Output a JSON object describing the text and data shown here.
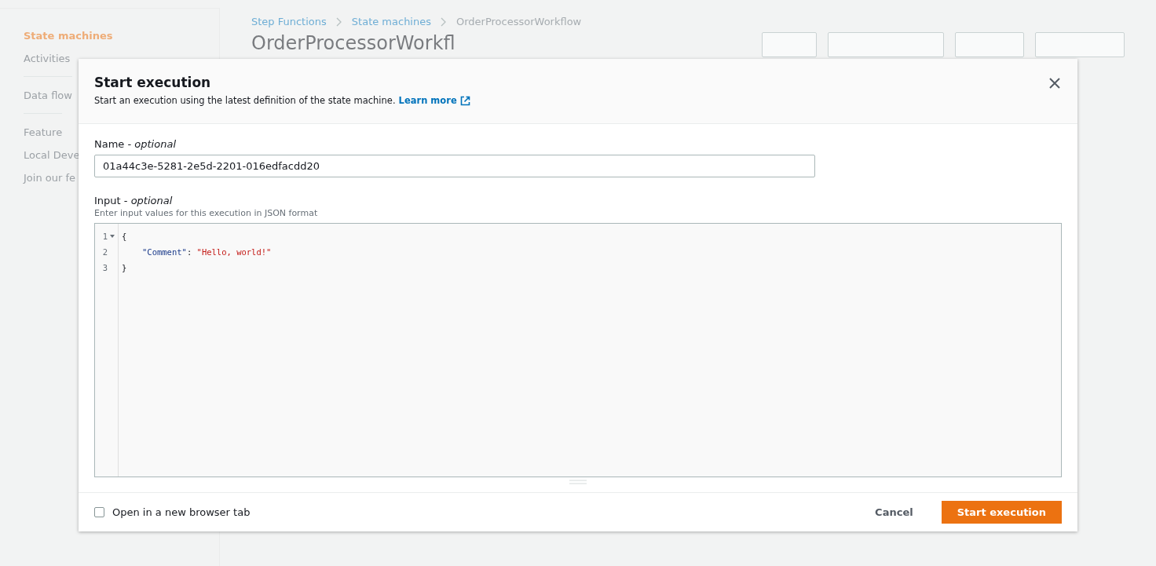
{
  "sidebar": {
    "items": [
      {
        "label": "State machines",
        "selected": true
      },
      {
        "label": "Activities",
        "selected": false
      },
      {
        "label": "Data flow",
        "selected": false
      },
      {
        "label": "Feature",
        "selected": false
      },
      {
        "label": "Local Deve",
        "selected": false
      },
      {
        "label": "Join our fe",
        "selected": false
      }
    ]
  },
  "breadcrumbs": [
    "Step Functions",
    "State machines",
    "OrderProcessorWorkflow"
  ],
  "page_title": "OrderProcessorWorkfl",
  "modal": {
    "title": "Start execution",
    "subtitle": "Start an execution using the latest definition of the state machine.",
    "learn_more": "Learn more",
    "name_field": {
      "label": "Name - *optional*",
      "value": "01a44c3e-5281-2e5d-2201-016edfacdd20"
    },
    "input_field": {
      "label": "Input - *optional*",
      "hint": "Enter input values for this execution in JSON format",
      "lines": [
        {
          "number": "1",
          "foldable": true,
          "indented": false,
          "tokens": [
            {
              "kind": "punct",
              "text": "{"
            }
          ]
        },
        {
          "number": "2",
          "foldable": false,
          "indented": true,
          "tokens": [
            {
              "kind": "key",
              "text": "\"Comment\""
            },
            {
              "kind": "punct",
              "text": ": "
            },
            {
              "kind": "string",
              "text": "\"Hello, world!\""
            }
          ]
        },
        {
          "number": "3",
          "foldable": false,
          "indented": false,
          "tokens": [
            {
              "kind": "punct",
              "text": "}"
            }
          ]
        }
      ]
    },
    "new_tab": {
      "label": "Open in a new browser tab",
      "checked": false
    },
    "buttons": [
      {
        "label": "Cancel",
        "kind": "link"
      },
      {
        "label": "Start execution",
        "kind": "primary"
      }
    ]
  }
}
